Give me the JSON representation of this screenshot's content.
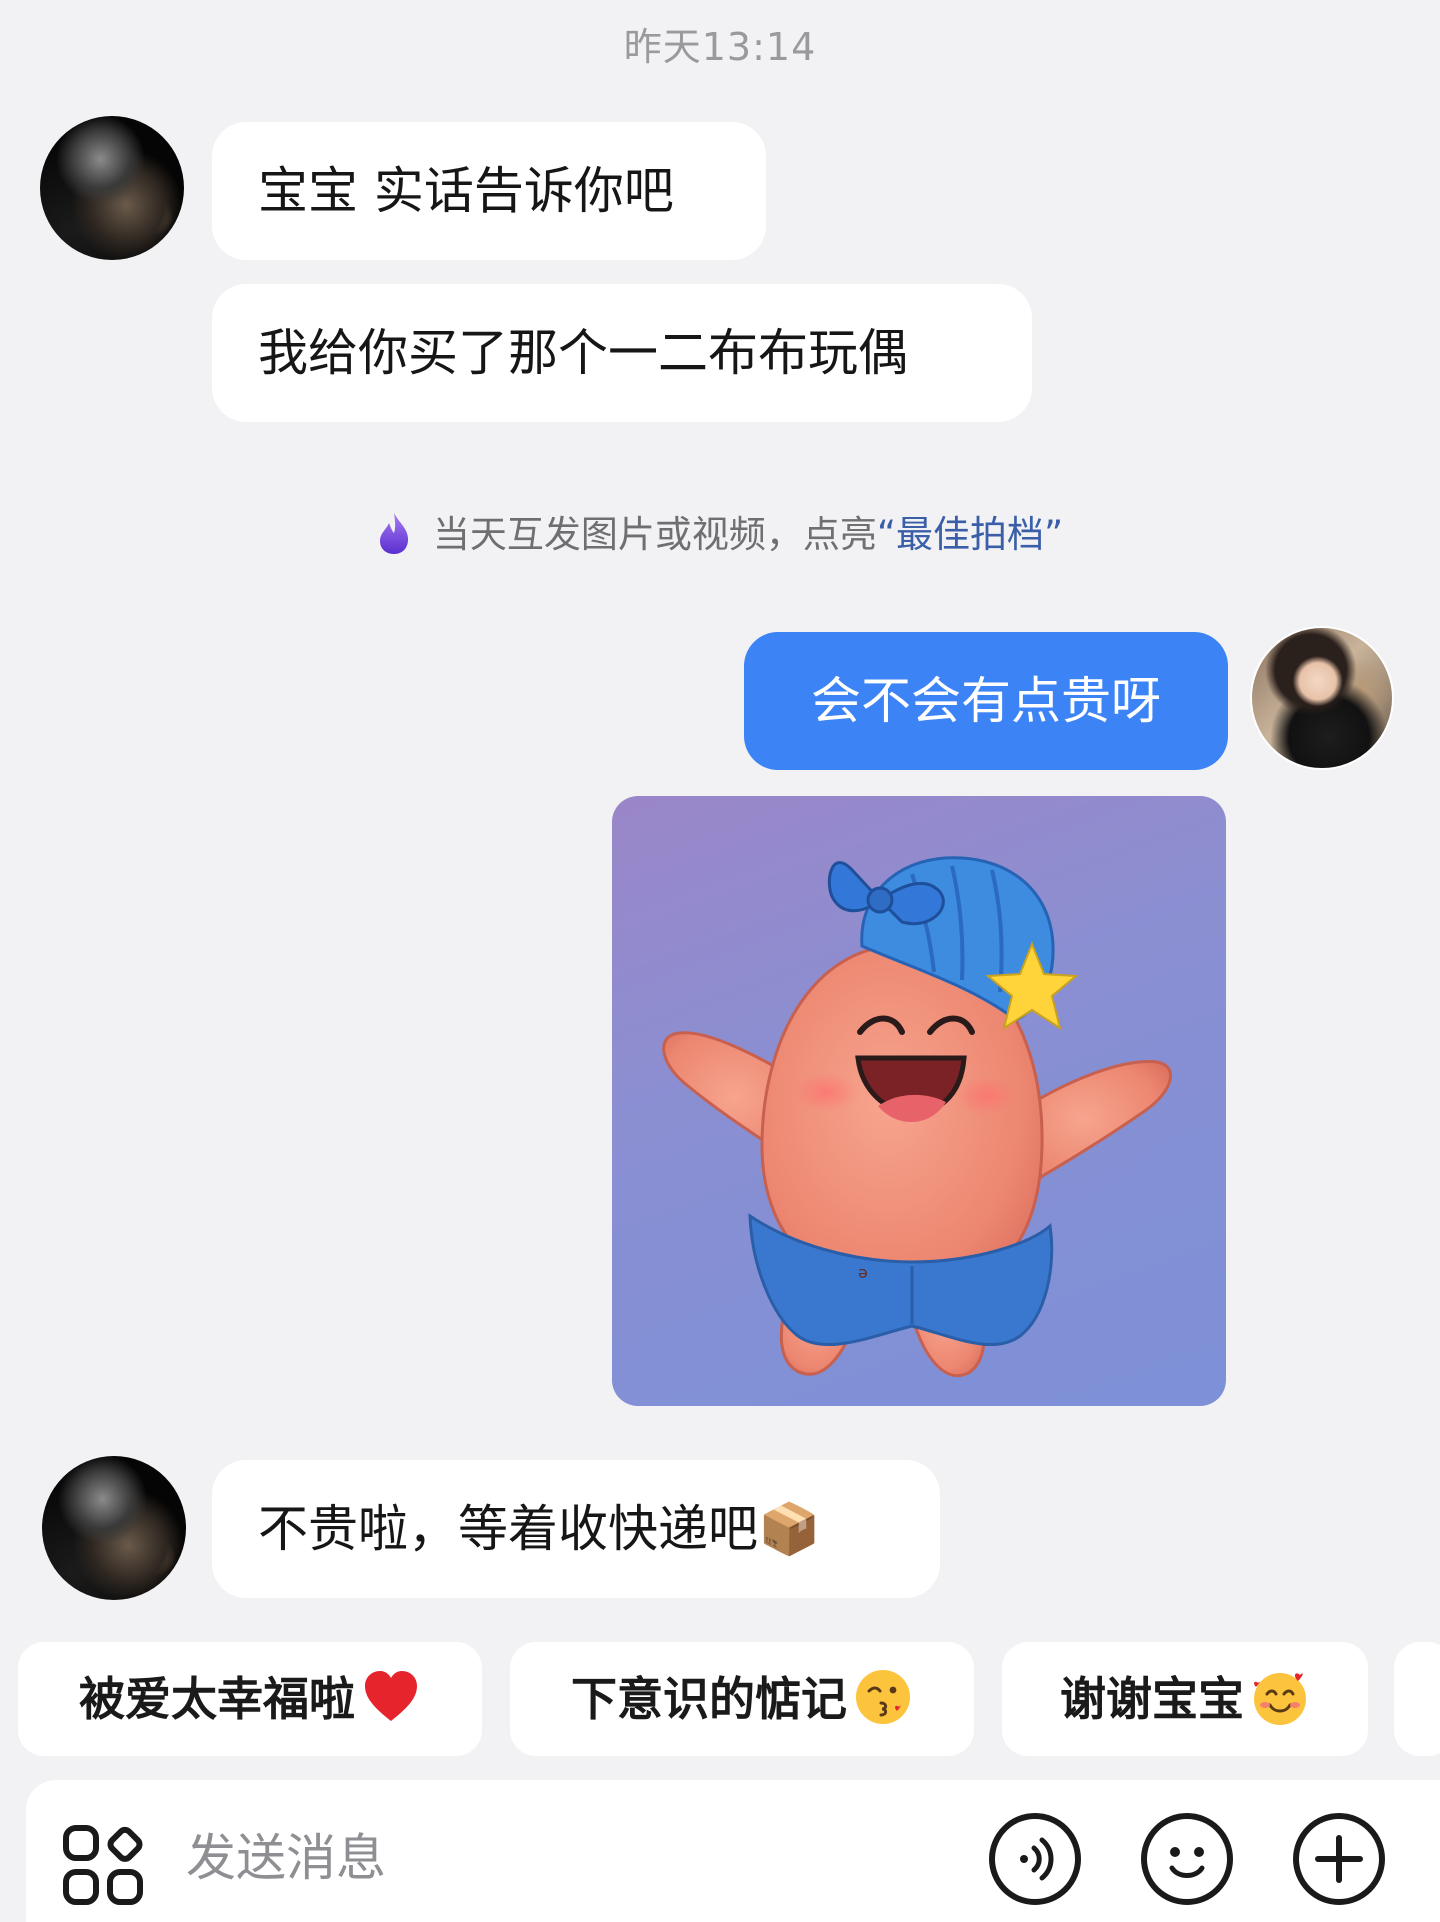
{
  "timestamp": "昨天13:14",
  "messages": {
    "m1": "宝宝 实话告诉你吧",
    "m2": "我给你买了那个一二布布玩偶",
    "m3": "会不会有点贵呀",
    "m4": "不贵啦，等着收快递吧📦"
  },
  "hint": {
    "prefix": "当天互发图片或视频，点亮",
    "highlight": "“最佳拍档”"
  },
  "quick_replies": [
    {
      "label": "被爱太幸福啦",
      "emoji": "red-heart"
    },
    {
      "label": "下意识的惦记",
      "emoji": "kissing-face"
    },
    {
      "label": "谢谢宝宝",
      "emoji": "smiling-face-with-hearts"
    }
  ],
  "input": {
    "placeholder": "发送消息"
  },
  "icons": {
    "apps": "apps-grid-icon",
    "voice": "voice-icon",
    "emoji": "emoji-icon",
    "plus": "plus-icon",
    "flame": "flame-icon"
  },
  "colors": {
    "background": "#f2f2f4",
    "my_bubble": "#3c83f6",
    "their_bubble": "#ffffff",
    "hint_highlight": "#3a5ea8",
    "flame": "#7b46e0"
  }
}
